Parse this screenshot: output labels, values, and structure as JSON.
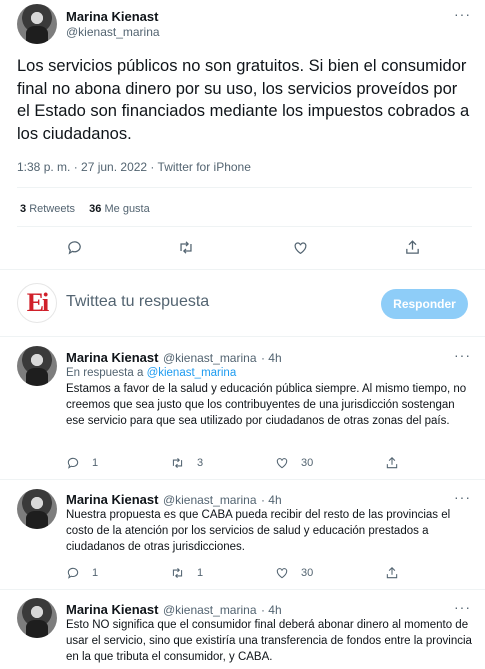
{
  "main_tweet": {
    "author_name": "Marina Kienast",
    "author_handle": "@kienast_marina",
    "text": "Los servicios públicos no son gratuitos. Si bien el consumidor final no abona dinero por su uso, los servicios proveídos por el Estado son financiados mediante los impuestos cobrados a los ciudadanos.",
    "timestamp": "1:38 p. m. · 27 jun. 2022 · Twitter for iPhone",
    "retweets_count": "3",
    "retweets_label": "Retweets",
    "likes_count": "36",
    "likes_label": "Me gusta"
  },
  "composer": {
    "logo_text": "Ei",
    "placeholder": "Twittea tu respuesta",
    "reply_button": "Responder"
  },
  "replies": [
    {
      "author_name": "Marina Kienast",
      "author_handle": "@kienast_marina",
      "time": "· 4h",
      "reply_to_prefix": "En respuesta a",
      "reply_to_handle": "@kienast_marina",
      "text": "Estamos a favor de la salud y educación pública siempre. Al mismo tiempo, no creemos que sea justo que los contribuyentes de una jurisdicción sostengan ese servicio para que sea utilizado por ciudadanos de otras zonas del país.",
      "replies_count": "1",
      "retweets_count": "3",
      "likes_count": "30"
    },
    {
      "author_name": "Marina Kienast",
      "author_handle": "@kienast_marina",
      "time": "· 4h",
      "text": "Nuestra propuesta es que CABA pueda recibir del resto de las provincias el costo de la atención por los servicios de salud y educación prestados a ciudadanos de otras jurisdicciones.",
      "replies_count": "1",
      "retweets_count": "1",
      "likes_count": "30"
    },
    {
      "author_name": "Marina Kienast",
      "author_handle": "@kienast_marina",
      "time": "· 4h",
      "text": "Esto NO significa que el consumidor final deberá abonar dinero al momento de usar el servicio, sino que existiría una transferencia de fondos entre la provincia en la que tributa el consumidor, y CABA."
    }
  ],
  "icons": {
    "more": "more-icon",
    "reply": "reply-icon",
    "retweet": "retweet-icon",
    "like": "heart-icon",
    "share": "share-icon"
  },
  "colors": {
    "accent": "#1d9bf0",
    "reply_button_bg": "#8ecdf8",
    "logo_red": "#d0202a",
    "secondary_text": "#536471"
  }
}
